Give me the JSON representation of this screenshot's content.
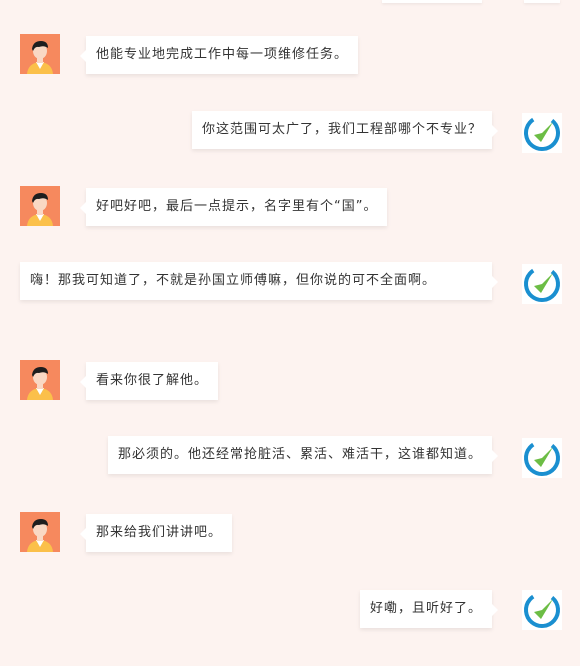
{
  "theme": {
    "background": "#fdf3f0",
    "bubble": "#ffffff",
    "text": "#333333",
    "avatar_bg": "#f6895e",
    "logo_blue": "#1a8fd0",
    "logo_green": "#6cbd45"
  },
  "avatars": {
    "person": "person-avatar",
    "company": "company-logo"
  },
  "messages": [
    {
      "side": "left",
      "text": "他能专业地完成工作中每一项维修任务。"
    },
    {
      "side": "right",
      "text": "你这范围可太广了，我们工程部哪个不专业？"
    },
    {
      "side": "left",
      "text": "好吧好吧，最后一点提示，名字里有个“国”。"
    },
    {
      "side": "right",
      "text": "嗨！那我可知道了，不就是孙国立师傅嘛，但你说的可不全面啊。"
    },
    {
      "side": "left",
      "text": "看来你很了解他。"
    },
    {
      "side": "right",
      "text": "那必须的。他还经常抢脏活、累活、难活干，这谁都知道。"
    },
    {
      "side": "left",
      "text": "那来给我们讲讲吧。"
    },
    {
      "side": "right",
      "text": "好嘞，且听好了。"
    }
  ]
}
